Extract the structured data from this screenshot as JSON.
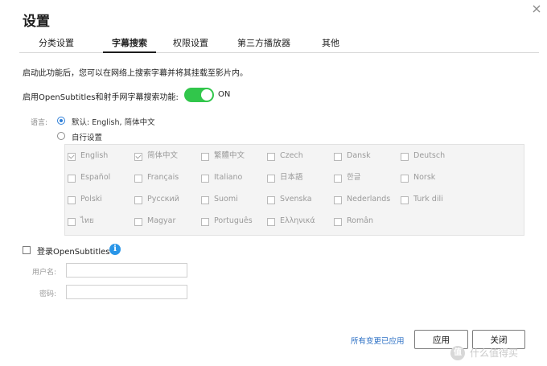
{
  "dialog": {
    "title": "设置",
    "close_icon": "close-icon"
  },
  "tabs": [
    {
      "label": "分类设置",
      "active": false
    },
    {
      "label": "字幕搜索",
      "active": true
    },
    {
      "label": "权限设置",
      "active": false
    },
    {
      "label": "第三方播放器",
      "active": false
    },
    {
      "label": "其他",
      "active": false
    }
  ],
  "subtitle_search": {
    "description": "启动此功能后，您可以在网络上搜索字幕并将其挂载至影片内。",
    "toggle_label": "启用OpenSubtitles和射手网字幕搜索功能:",
    "toggle_state": "ON",
    "toggle_on": true,
    "toggle_color": "#31c64b"
  },
  "language": {
    "label": "语言:",
    "default_option": "默认: English, 简体中文",
    "custom_option": "自行设置",
    "selected": "default",
    "items": [
      {
        "name": "English",
        "checked": true
      },
      {
        "name": "简体中文",
        "checked": true
      },
      {
        "name": "繁體中文",
        "checked": false
      },
      {
        "name": "Czech",
        "checked": false
      },
      {
        "name": "Dansk",
        "checked": false
      },
      {
        "name": "Deutsch",
        "checked": false
      },
      {
        "name": "Español",
        "checked": false
      },
      {
        "name": "Français",
        "checked": false
      },
      {
        "name": "Italiano",
        "checked": false
      },
      {
        "name": "日本語",
        "checked": false
      },
      {
        "name": "한글",
        "checked": false
      },
      {
        "name": "Norsk",
        "checked": false
      },
      {
        "name": "Polski",
        "checked": false
      },
      {
        "name": "Русский",
        "checked": false
      },
      {
        "name": "Suomi",
        "checked": false
      },
      {
        "name": "Svenska",
        "checked": false
      },
      {
        "name": "Nederlands",
        "checked": false
      },
      {
        "name": "Turk dili",
        "checked": false
      },
      {
        "name": "ไทย",
        "checked": false
      },
      {
        "name": "Magyar",
        "checked": false
      },
      {
        "name": "Português",
        "checked": false
      },
      {
        "name": "Ελληνικά",
        "checked": false
      },
      {
        "name": "Român",
        "checked": false
      }
    ]
  },
  "login": {
    "checkbox_label": "登录OpenSubtitles",
    "info_icon": "info-icon",
    "info_glyph": "i",
    "username_label": "用户名:",
    "username_value": "",
    "password_label": "密码:",
    "password_value": ""
  },
  "footer": {
    "applied_text": "所有变更已应用",
    "apply_button": "应用",
    "close_button": "关闭",
    "link_color": "#2b6fc4"
  },
  "watermark": {
    "logo_glyph": "值",
    "text": "什么值得买"
  }
}
